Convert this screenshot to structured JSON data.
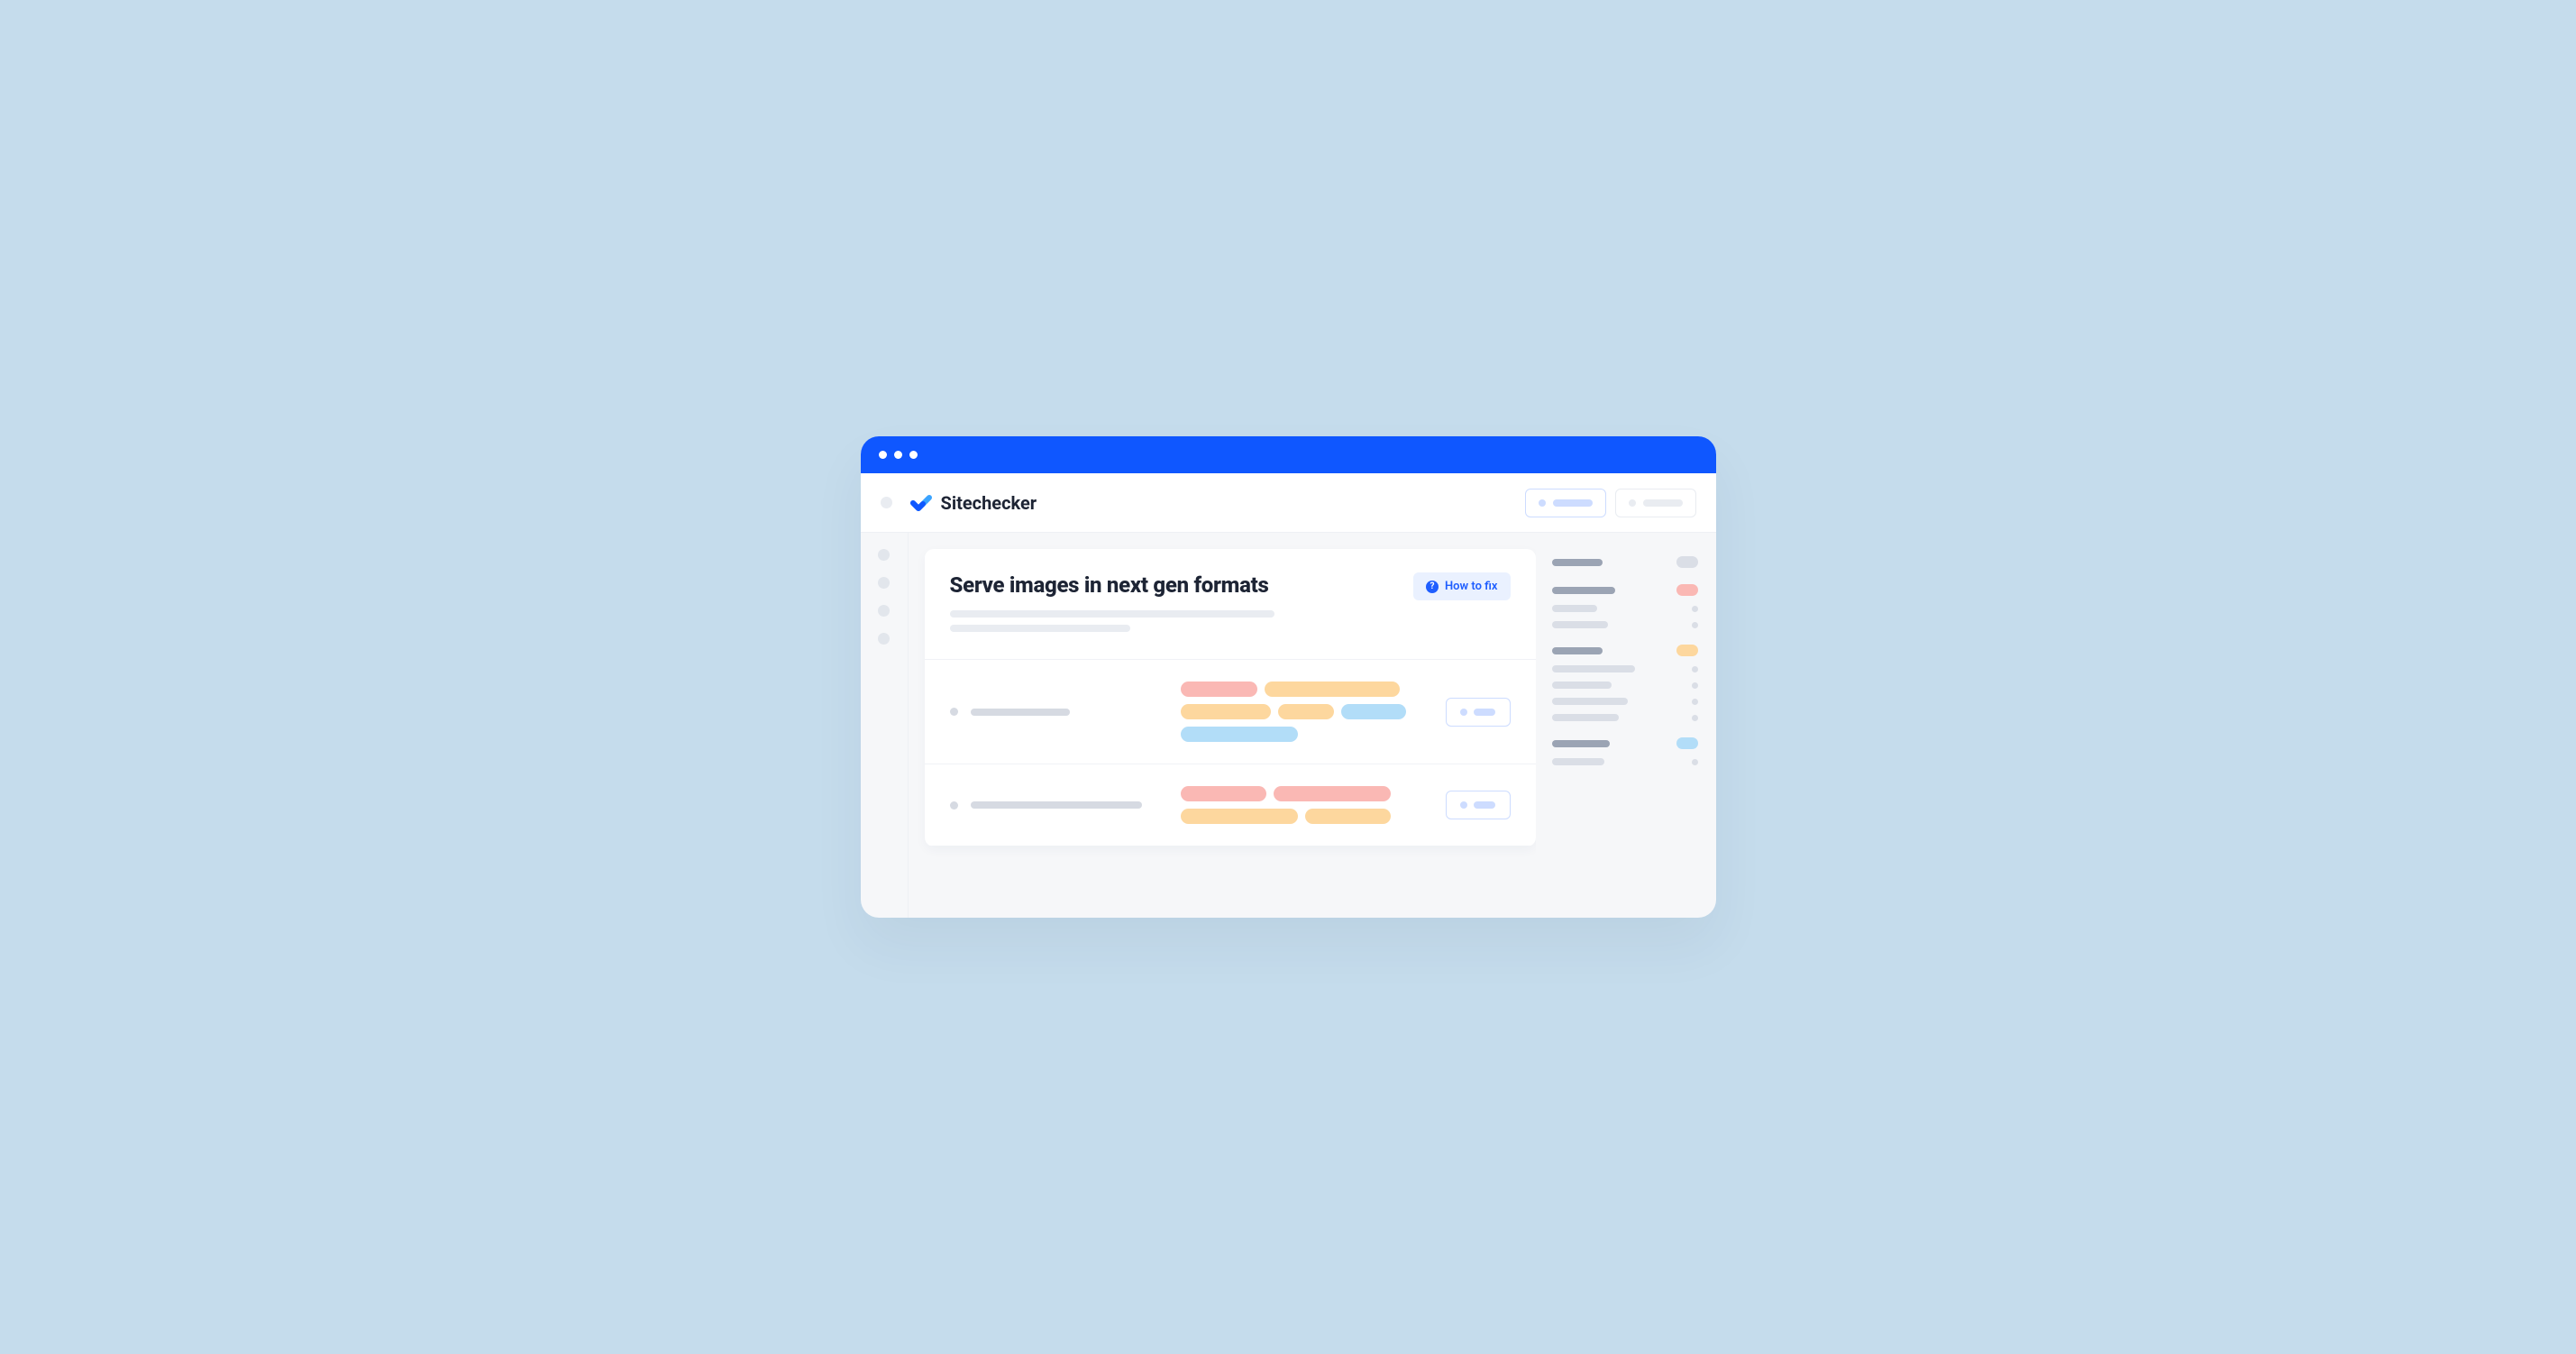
{
  "brand": {
    "name": "Sitechecker"
  },
  "page": {
    "title": "Serve images in next gen formats",
    "howToFixLabel": "How to fix"
  }
}
